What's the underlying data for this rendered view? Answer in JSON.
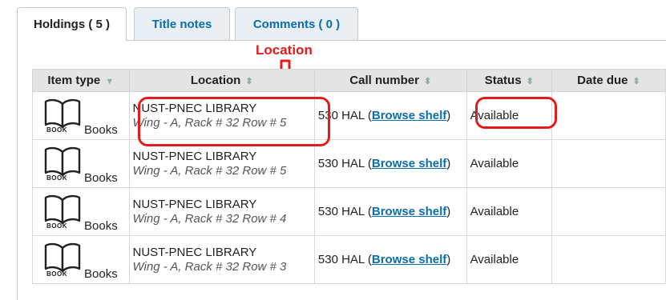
{
  "tabs": [
    {
      "label": "Holdings ( 5 )",
      "active": true
    },
    {
      "label": "Title notes",
      "active": false
    },
    {
      "label": "Comments ( 0 )",
      "active": false
    }
  ],
  "annotation": {
    "label": "Location",
    "color": "#e31b1b"
  },
  "table": {
    "headers": [
      "Item type",
      "Location",
      "Call number",
      "Status",
      "Date due"
    ],
    "sort_icons": {
      "item_type": "sort-desc-icon",
      "others": "sort-both-icon"
    },
    "rows": [
      {
        "book_caption": "BOOK",
        "item_type": "Books",
        "library": "NUST-PNEC LIBRARY",
        "shelf": "Wing - A, Rack # 32 Row # 5",
        "call_prefix": "530 HAL (",
        "browse_label": "Browse shelf",
        "call_suffix": ")",
        "status": "Available",
        "date_due": ""
      },
      {
        "book_caption": "BOOK",
        "item_type": "Books",
        "library": "NUST-PNEC LIBRARY",
        "shelf": "Wing - A, Rack # 32 Row # 5",
        "call_prefix": "530 HAL (",
        "browse_label": "Browse shelf",
        "call_suffix": ")",
        "status": "Available",
        "date_due": ""
      },
      {
        "book_caption": "BOOK",
        "item_type": "Books",
        "library": "NUST-PNEC LIBRARY",
        "shelf": "Wing - A, Rack # 32 Row # 4",
        "call_prefix": "530 HAL (",
        "browse_label": "Browse shelf",
        "call_suffix": ")",
        "status": "Available",
        "date_due": ""
      },
      {
        "book_caption": "BOOK",
        "item_type": "Books",
        "library": "NUST-PNEC LIBRARY",
        "shelf": "Wing - A, Rack # 32 Row # 3",
        "call_prefix": "530 HAL (",
        "browse_label": "Browse shelf",
        "call_suffix": ")",
        "status": "Available",
        "date_due": ""
      }
    ]
  },
  "colors": {
    "link": "#0a6fa8",
    "highlight": "#e31b1b",
    "header_bg": "#e4e4e4"
  }
}
